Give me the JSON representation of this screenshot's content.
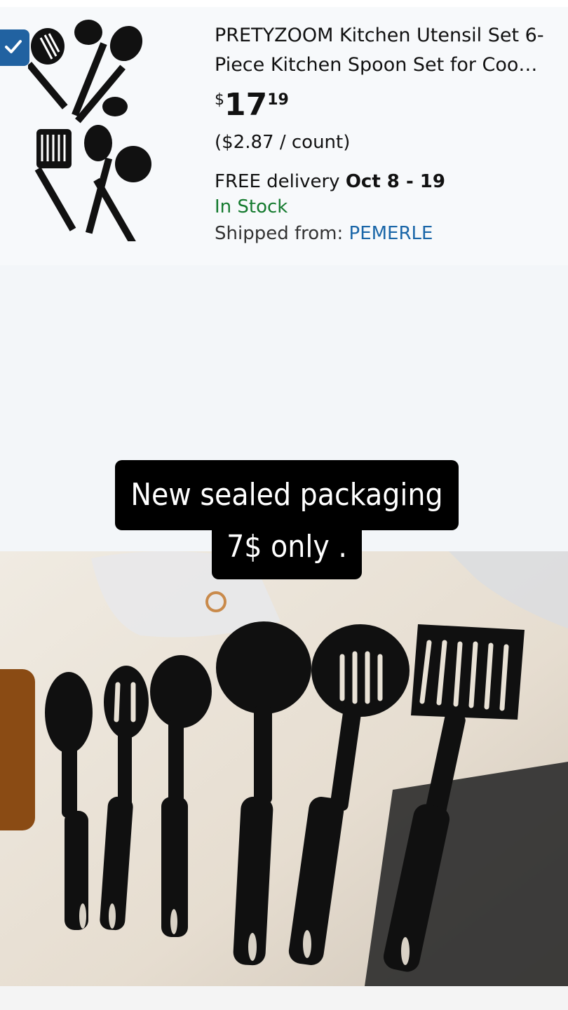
{
  "product": {
    "title_line1": "PRETYZOOM Kitchen Utensil Set 6-",
    "title_line2": "Piece Kitchen Spoon Set for Coo…",
    "price_symbol": "$",
    "price_whole": "17",
    "price_fraction": "19",
    "unit_price": "($2.87 / count)",
    "delivery_prefix": "FREE delivery ",
    "delivery_dates": "Oct 8 - 19",
    "stock_status": "In Stock",
    "shipped_label": "Shipped from: ",
    "shipped_seller": "PEMERLE",
    "selected": true,
    "thumbnail_icon": "kitchen-utensils-thumbnail"
  },
  "overlay": {
    "caption_line1": "New sealed packaging",
    "caption_line2": "7$ only ."
  },
  "photo": {
    "subject": "utensil-photo"
  },
  "colors": {
    "checkbox_blue": "#2162a1",
    "stock_green": "#147a2e",
    "link_blue": "#1a66a8"
  }
}
